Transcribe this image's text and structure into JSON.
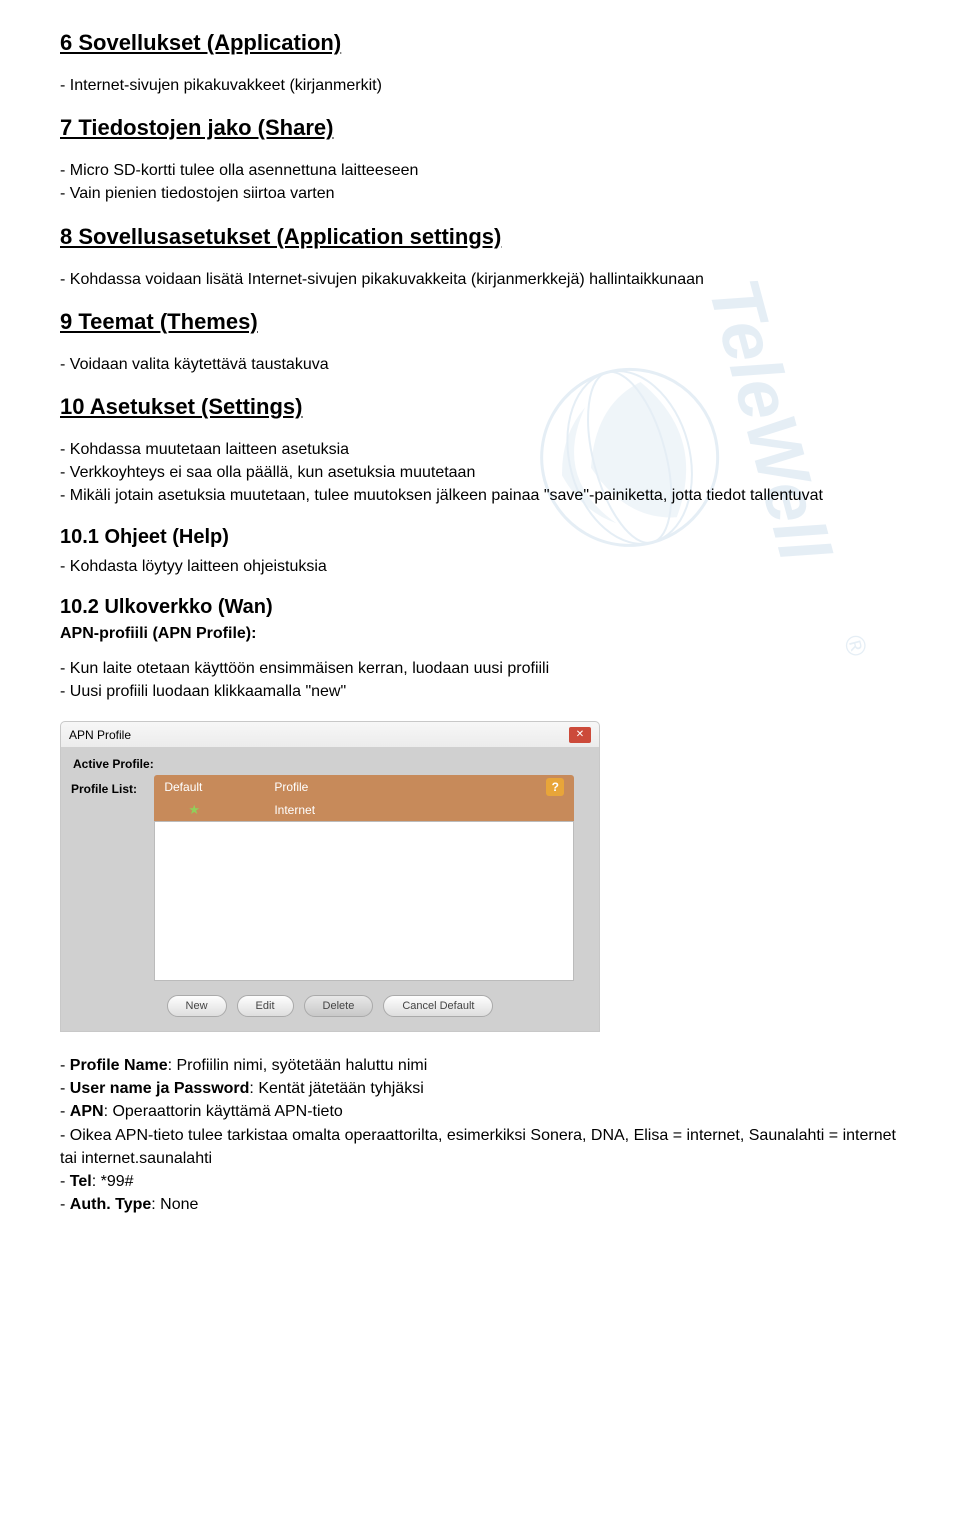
{
  "sections": {
    "s6": {
      "title": "6 Sovellukset (Application)",
      "line1": "- Internet-sivujen pikakuvakkeet (kirjanmerkit)"
    },
    "s7": {
      "title": "7 Tiedostojen jako (Share)",
      "line1": "- Micro SD-kortti tulee olla asennettuna laitteeseen",
      "line2": "- Vain pienien tiedostojen siirtoa varten"
    },
    "s8": {
      "title": "8 Sovellusasetukset (Application settings)",
      "line1": "- Kohdassa voidaan lisätä Internet-sivujen pikakuvakkeita (kirjanmerkkejä) hallintaikkunaan"
    },
    "s9": {
      "title": "9 Teemat (Themes)",
      "line1": "- Voidaan valita käytettävä taustakuva"
    },
    "s10": {
      "title": "10 Asetukset (Settings)",
      "line1": "- Kohdassa muutetaan laitteen asetuksia",
      "line2": "- Verkkoyhteys ei saa olla päällä, kun asetuksia muutetaan",
      "line3": "- Mikäli jotain asetuksia muutetaan, tulee muutoksen jälkeen painaa \"save\"-painiketta, jotta tiedot tallentuvat"
    },
    "s10_1": {
      "title": "10.1 Ohjeet (Help)",
      "line1": "- Kohdasta löytyy laitteen ohjeistuksia"
    },
    "s10_2": {
      "title": "10.2 Ulkoverkko (Wan)",
      "sub": "APN-profiili (APN Profile):",
      "line1": "- Kun laite otetaan käyttöön ensimmäisen kerran, luodaan uusi profiili",
      "line2": "- Uusi profiili luodaan klikkaamalla \"new\""
    },
    "footer": {
      "l1a": "- ",
      "l1b": "Profile Name",
      "l1c": ": Profiilin nimi, syötetään haluttu nimi",
      "l2a": "- ",
      "l2b": "User name ja Password",
      "l2c": ": Kentät jätetään tyhjäksi",
      "l3a": "- ",
      "l3b": "APN",
      "l3c": ": Operaattorin käyttämä APN-tieto",
      "l4": "- Oikea APN-tieto tulee tarkistaa omalta operaattorilta, esimerkiksi Sonera, DNA, Elisa = internet, Saunalahti = internet tai internet.saunalahti",
      "l5a": "- ",
      "l5b": "Tel",
      "l5c": ": *99#",
      "l6a": "- ",
      "l6b": "Auth. Type",
      "l6c": ": None"
    }
  },
  "dialog": {
    "title": "APN Profile",
    "active_label": "Active Profile:",
    "list_label": "Profile List:",
    "col_default": "Default",
    "col_profile": "Profile",
    "row_profile": "Internet",
    "help": "?",
    "close": "✕",
    "btn_new": "New",
    "btn_edit": "Edit",
    "btn_delete": "Delete",
    "btn_cancel": "Cancel Default"
  },
  "watermark": "TeleWell"
}
